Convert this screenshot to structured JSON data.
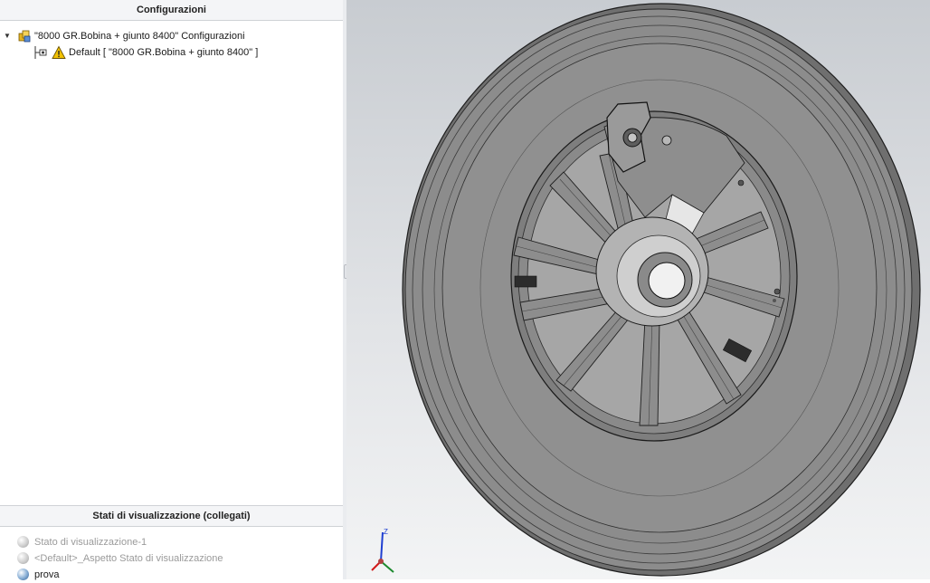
{
  "configurations": {
    "header": "Configurazioni",
    "root_label": "\"8000 GR.Bobina + giunto 8400\" Configurazioni",
    "items": [
      {
        "label": "Default [ \"8000 GR.Bobina + giunto 8400\" ]",
        "warning": true
      }
    ]
  },
  "display_states": {
    "header": "Stati di visualizzazione (collegati)",
    "items": [
      {
        "label": "Stato di visualizzazione-1",
        "active": false
      },
      {
        "label": "<Default>_Aspetto Stato di visualizzazione",
        "active": false
      },
      {
        "label": "prova",
        "active": true
      }
    ]
  },
  "viewport": {
    "model_color": "#8c8c8c",
    "triad_axes": [
      "Z",
      "Y",
      "X"
    ]
  },
  "colors": {
    "warning": "#f2c200",
    "axis_x": "#d11a1a",
    "axis_y": "#1c8a2e",
    "axis_z": "#1f3fd1"
  }
}
